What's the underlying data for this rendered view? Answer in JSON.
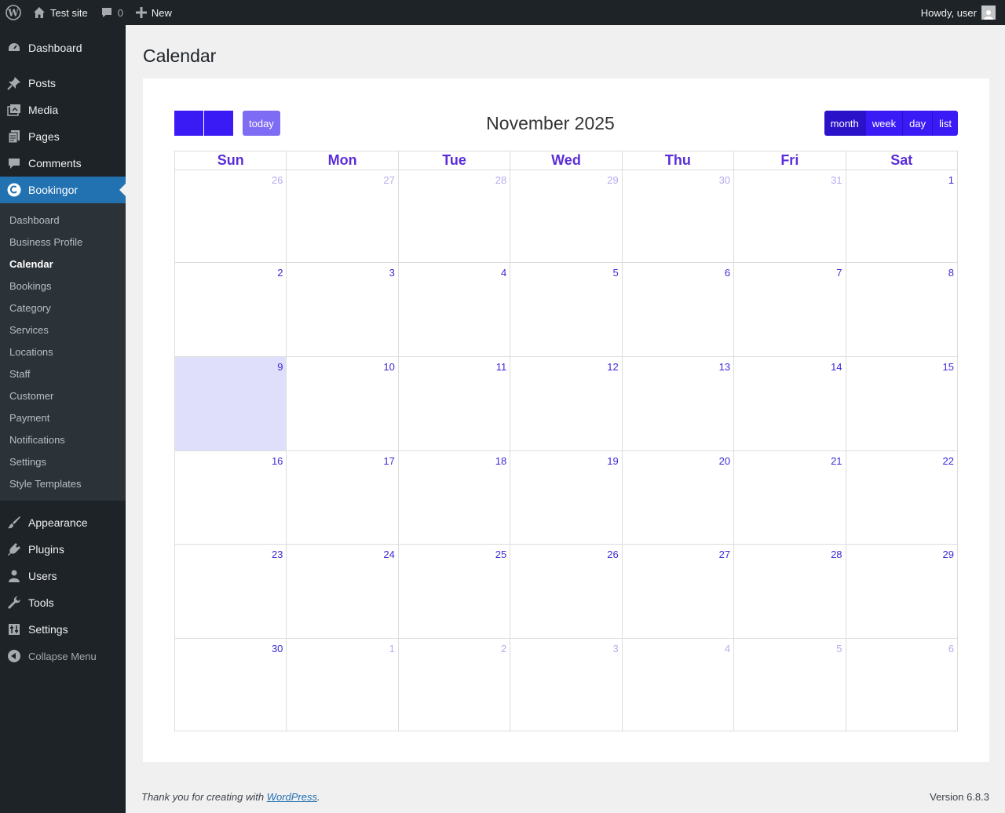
{
  "adminbar": {
    "site_name": "Test site",
    "comments_count": "0",
    "new_label": "New",
    "greeting": "Howdy, user"
  },
  "sidebar": {
    "top_items": [
      {
        "label": "Dashboard",
        "icon": "dashboard-icon"
      },
      {
        "label": "Posts",
        "icon": "pushpin-icon"
      },
      {
        "label": "Media",
        "icon": "media-icon"
      },
      {
        "label": "Pages",
        "icon": "pages-icon"
      },
      {
        "label": "Comments",
        "icon": "comment-icon"
      },
      {
        "label": "Bookingor",
        "icon": "bookingor-icon"
      }
    ],
    "submenu": [
      "Dashboard",
      "Business Profile",
      "Calendar",
      "Bookings",
      "Category",
      "Services",
      "Locations",
      "Staff",
      "Customer",
      "Payment",
      "Notifications",
      "Settings",
      "Style Templates"
    ],
    "submenu_active": "Calendar",
    "bottom_items": [
      {
        "label": "Appearance",
        "icon": "paintbrush-icon"
      },
      {
        "label": "Plugins",
        "icon": "plugin-icon"
      },
      {
        "label": "Users",
        "icon": "users-icon"
      },
      {
        "label": "Tools",
        "icon": "wrench-icon"
      },
      {
        "label": "Settings",
        "icon": "settings-icon"
      }
    ],
    "collapse_label": "Collapse Menu"
  },
  "page": {
    "title": "Calendar"
  },
  "calendar": {
    "title": "November 2025",
    "today_label": "today",
    "views": [
      "month",
      "week",
      "day",
      "list"
    ],
    "active_view": "month",
    "weekdays": [
      "Sun",
      "Mon",
      "Tue",
      "Wed",
      "Thu",
      "Fri",
      "Sat"
    ],
    "weeks": [
      [
        "26",
        "27",
        "28",
        "29",
        "30",
        "31",
        "1"
      ],
      [
        "2",
        "3",
        "4",
        "5",
        "6",
        "7",
        "8"
      ],
      [
        "9",
        "10",
        "11",
        "12",
        "13",
        "14",
        "15"
      ],
      [
        "16",
        "17",
        "18",
        "19",
        "20",
        "21",
        "22"
      ],
      [
        "23",
        "24",
        "25",
        "26",
        "27",
        "28",
        "29"
      ],
      [
        "30",
        "1",
        "2",
        "3",
        "4",
        "5",
        "6"
      ]
    ],
    "today": "9",
    "colors": {
      "primary": "#3b1bf5",
      "today_bg": "#dfdffc",
      "day_number": "#3b2ad9",
      "other_month": "#b3abf0",
      "header": "#5b2ed9"
    }
  },
  "footer": {
    "thanks_prefix": "Thank you for creating with ",
    "thanks_link": "WordPress",
    "thanks_suffix": ".",
    "version": "Version 6.8.3"
  }
}
